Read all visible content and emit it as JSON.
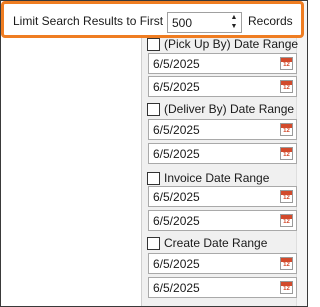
{
  "limit": {
    "label": "Limit Search Results to First",
    "value": "500",
    "units": "Records",
    "spin_up_glyph": "▲",
    "spin_down_glyph": "▼"
  },
  "date_ranges": [
    {
      "label": "(Pick Up By) Date Range",
      "checked": false,
      "from": "6/5/2025",
      "to": "6/5/2025"
    },
    {
      "label": "(Deliver By) Date Range",
      "checked": false,
      "from": "6/5/2025",
      "to": "6/5/2025"
    },
    {
      "label": "Invoice Date Range",
      "checked": false,
      "from": "6/5/2025",
      "to": "6/5/2025"
    },
    {
      "label": "Create Date Range",
      "checked": false,
      "from": "6/5/2025",
      "to": "6/5/2025"
    }
  ],
  "calendar_icon": {
    "name": "calendar-icon",
    "number": "12"
  },
  "colors": {
    "highlight": "#ef7d22",
    "panel": "#f0f0f0",
    "calendar_red": "#d24a2c"
  }
}
